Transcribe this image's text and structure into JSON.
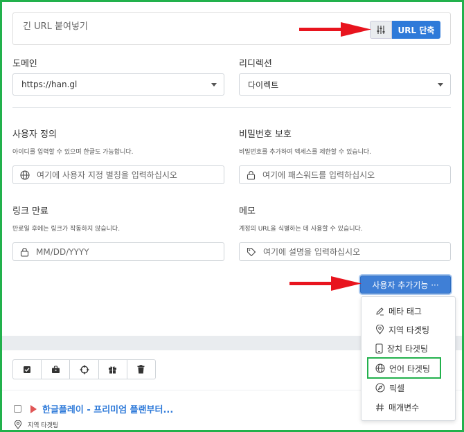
{
  "url_bar": {
    "placeholder": "긴 URL 붙여넣기",
    "options_icon": "sliders-icon",
    "shorten_label": "URL 단축"
  },
  "domain": {
    "label": "도메인",
    "value": "https://han.gl"
  },
  "redirect": {
    "label": "리디렉션",
    "value": "다이렉트"
  },
  "custom_alias": {
    "label": "사용자 정의",
    "help": "아이디를 입력할 수 있으며 한글도 가능합니다.",
    "placeholder": "여기에 사용자 지정 별칭을 입력하십시오",
    "icon": "globe-icon"
  },
  "password": {
    "label": "비밀번호 보호",
    "help": "비밀번호를 추가하여 액세스를 제한할 수 있습니다.",
    "placeholder": "여기에 패스워드를 입력하십시오",
    "icon": "lock-icon"
  },
  "expiry": {
    "label": "링크 만료",
    "help": "만료일 후에는 링크가 작동하지 않습니다.",
    "placeholder": "MM/DD/YYYY",
    "icon": "lock-icon"
  },
  "memo": {
    "label": "메모",
    "help": "계정의 URL을 식별하는 데 사용할 수 있습니다.",
    "placeholder": "여기에 설명을 입력하십시오",
    "icon": "tag-icon"
  },
  "more_features": {
    "label": "사용자 추가기능 ···"
  },
  "menu": {
    "items": [
      {
        "label": "메타 태그",
        "icon": "pencil-icon"
      },
      {
        "label": "지역 타겟팅",
        "icon": "map-pin-icon"
      },
      {
        "label": "장치 타겟팅",
        "icon": "phone-icon"
      },
      {
        "label": "언어 타겟팅",
        "icon": "globe-icon"
      },
      {
        "label": "픽셀",
        "icon": "compass-icon"
      },
      {
        "label": "매개변수",
        "icon": "hash-icon"
      }
    ]
  },
  "toolbar": {
    "icons": [
      "check-square-icon",
      "briefcase-icon",
      "crosshair-icon",
      "gift-icon",
      "trash-icon"
    ]
  },
  "link_row": {
    "title": "한글플레이 - 프리미엄 플랜부터...",
    "geo_label": "지역 타겟팅"
  },
  "colors": {
    "primary": "#2e7ad9",
    "highlight": "#22b14c",
    "arrow": "#e8141e"
  }
}
